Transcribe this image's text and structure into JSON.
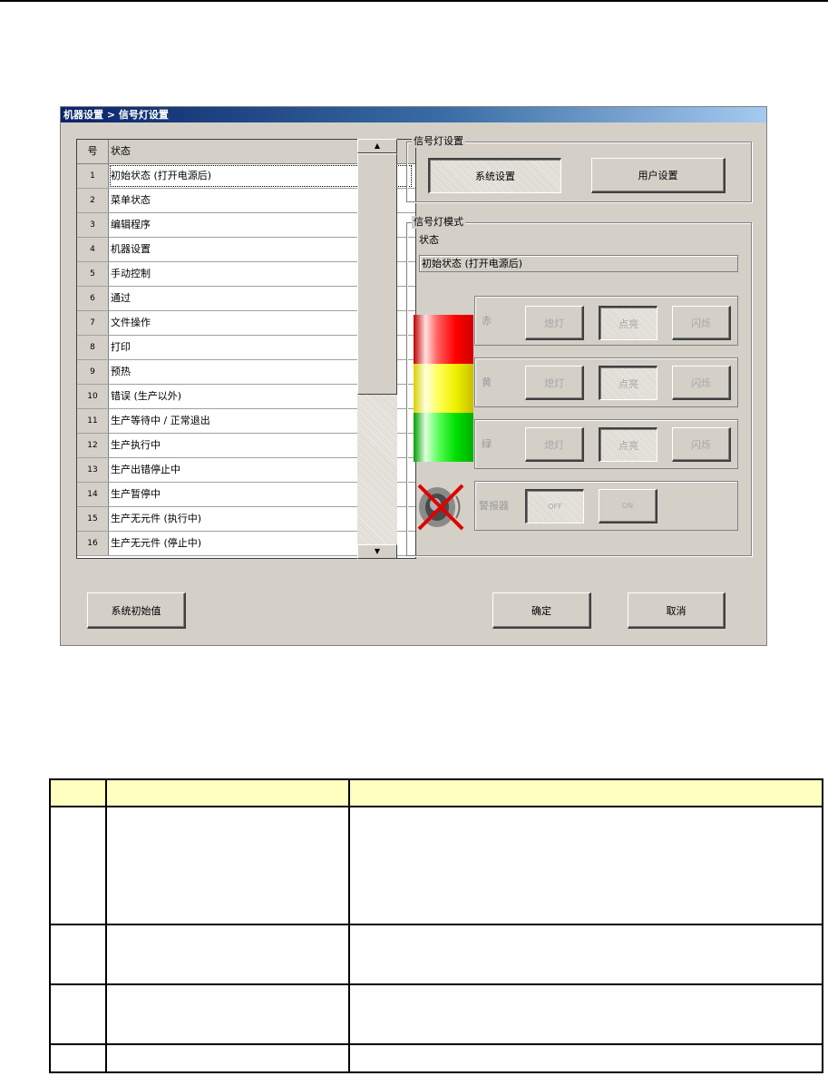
{
  "window": {
    "title": "机器设置 > 信号灯设置"
  },
  "table": {
    "col_num": "号",
    "col_state": "状态",
    "rows": [
      {
        "num": "1",
        "state": "初始状态 (打开电源后)"
      },
      {
        "num": "2",
        "state": "菜单状态"
      },
      {
        "num": "3",
        "state": "编辑程序"
      },
      {
        "num": "4",
        "state": "机器设置"
      },
      {
        "num": "5",
        "state": "手动控制"
      },
      {
        "num": "6",
        "state": "通过"
      },
      {
        "num": "7",
        "state": "文件操作"
      },
      {
        "num": "8",
        "state": "打印"
      },
      {
        "num": "9",
        "state": "预热"
      },
      {
        "num": "10",
        "state": "错误 (生产以外)"
      },
      {
        "num": "11",
        "state": "生产等待中 / 正常退出"
      },
      {
        "num": "12",
        "state": "生产执行中"
      },
      {
        "num": "13",
        "state": "生产出错停止中"
      },
      {
        "num": "14",
        "state": "生产暂停中"
      },
      {
        "num": "15",
        "state": "生产无元件 (执行中)"
      },
      {
        "num": "16",
        "state": "生产无元件 (停止中)"
      }
    ],
    "selected_index": 0
  },
  "signal_setting": {
    "group_title": "信号灯设置",
    "system_button": "系统设置",
    "user_button": "用户设置",
    "active": "system"
  },
  "signal_mode": {
    "group_title": "信号灯模式",
    "state_label": "状态",
    "state_value": "初始状态 (打开电源后)",
    "lights": [
      {
        "name": "赤",
        "off": "熄灯",
        "on": "点亮",
        "blink": "闪烁",
        "selected": "on",
        "color": "#e00000"
      },
      {
        "name": "黄",
        "off": "熄灯",
        "on": "点亮",
        "blink": "闪烁",
        "selected": "on",
        "color": "#e8e000"
      },
      {
        "name": "绿",
        "off": "熄灯",
        "on": "点亮",
        "blink": "闪烁",
        "selected": "on",
        "color": "#00c000"
      }
    ],
    "buzzer": {
      "label": "警报器",
      "off": "OFF",
      "on": "ON",
      "selected": "off",
      "icon": "muted-speaker-icon"
    }
  },
  "footer": {
    "reset_button": "系统初始值",
    "ok_button": "确定",
    "cancel_button": "取消"
  }
}
